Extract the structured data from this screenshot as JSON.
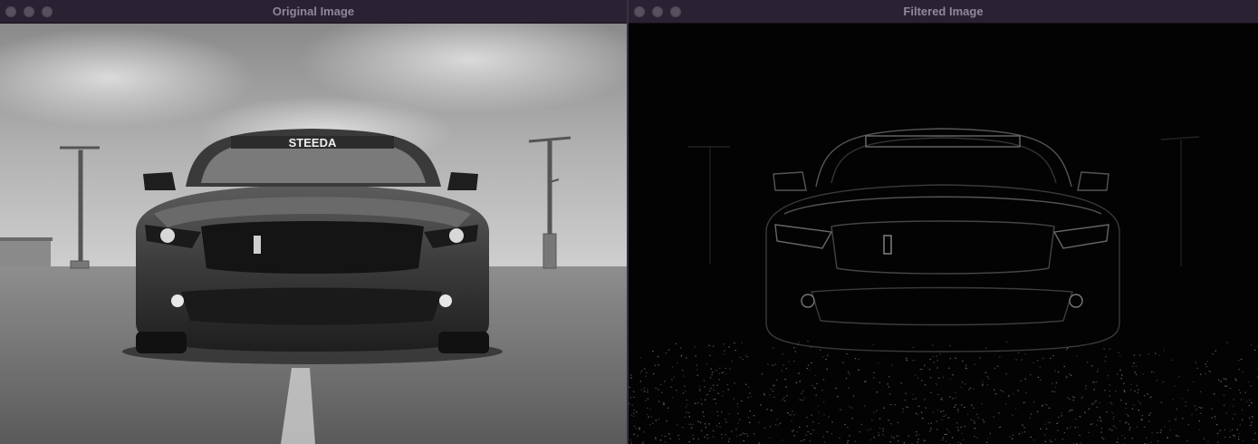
{
  "windows": {
    "original": {
      "title": "Original Image"
    },
    "filtered": {
      "title": "Filtered Image"
    }
  },
  "image": {
    "windshield_banner": "STEEDA",
    "description_icons": [
      "car-photo",
      "street-lamp"
    ]
  },
  "colors": {
    "titlebar": "#2a2233",
    "title_text": "#8f8899",
    "traffic_light": "#58505e",
    "filtered_bg": "#000000",
    "edge_color": "#5a5a5a"
  }
}
